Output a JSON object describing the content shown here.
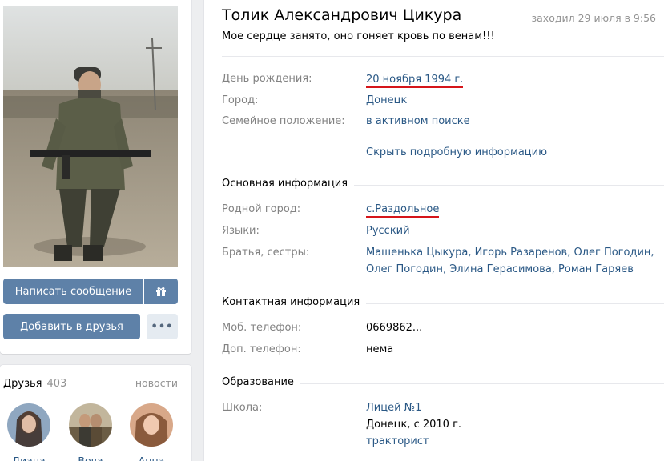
{
  "sidebar": {
    "buttons": {
      "message": "Написать сообщение",
      "add_friend": "Добавить в друзья",
      "more": "•••"
    },
    "friends": {
      "title": "Друзья",
      "count": "403",
      "news_link": "новости",
      "items": [
        {
          "name": "Диана"
        },
        {
          "name": "Вова"
        },
        {
          "name": "Анна"
        }
      ]
    }
  },
  "profile": {
    "name": "Толик Александрович Цикура",
    "last_seen": "заходил 29 июля в 9:56",
    "status": "Мое сердце занято, оно гоняет кровь по венам!!!",
    "short_info": [
      {
        "label": "День рождения:",
        "value": "20 ноября 1994 г."
      },
      {
        "label": "Город:",
        "value": "Донецк"
      },
      {
        "label": "Семейное положение:",
        "value": "в активном поиске"
      }
    ],
    "hide_details_link": "Скрыть подробную информацию",
    "sections": {
      "main_info": {
        "title": "Основная информация",
        "hometown_label": "Родной город:",
        "hometown_prefix": "с.",
        "hometown_value": "Раздольное",
        "languages_label": "Языки:",
        "languages_value": "Русский",
        "siblings_label": "Братья, сестры:",
        "siblings": [
          "Машенька Цыкура",
          "Игорь Разаренов",
          "Олег Погодин",
          "Олег Погодин",
          "Элина Герасимова",
          "Роман Гаряев"
        ]
      },
      "contacts": {
        "title": "Контактная информация",
        "mobile_label": "Моб. телефон:",
        "mobile_value": "0669862...",
        "extra_label": "Доп. телефон:",
        "extra_value": "нема"
      },
      "education": {
        "title": "Образование",
        "school_label": "Школа:",
        "school_name": "Лицей №1",
        "school_detail": "Донецк, с 2010 г.",
        "school_spec": "тракторист"
      }
    }
  },
  "colors": {
    "accent_button": "#5e81a8",
    "link": "#2a5885",
    "label": "#828282",
    "highlight": "#d5151a"
  }
}
